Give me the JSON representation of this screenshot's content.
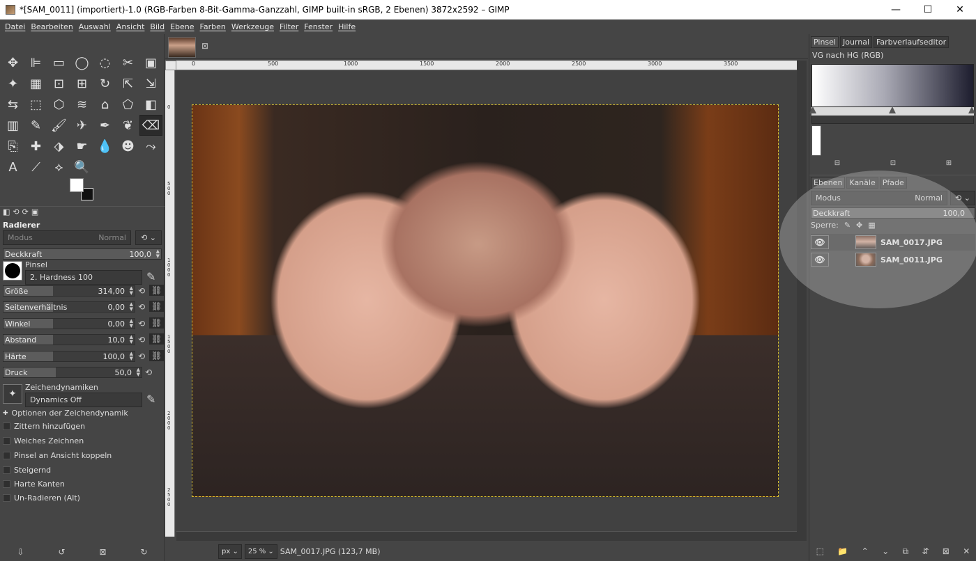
{
  "window": {
    "title": "*[SAM_0011] (importiert)-1.0 (RGB-Farben 8-Bit-Gamma-Ganzzahl, GIMP built-in sRGB, 2 Ebenen) 3872x2592 – GIMP",
    "min": "—",
    "max": "☐",
    "close": "✕"
  },
  "menu": [
    "Datei",
    "Bearbeiten",
    "Auswahl",
    "Ansicht",
    "Bild",
    "Ebene",
    "Farben",
    "Werkzeuge",
    "Filter",
    "Fenster",
    "Hilfe"
  ],
  "tools": [
    "move-tool",
    "align-tool",
    "rect-select-tool",
    "ellipse-select-tool",
    "free-select-tool",
    "scissors-tool",
    "foreground-select-tool",
    "fuzzy-select-tool",
    "color-select-tool",
    "crop-tool",
    "unified-transform-tool",
    "rotate-tool",
    "scale-tool",
    "shear-tool",
    "flip-tool",
    "perspective-tool",
    "3d-transform-tool",
    "warp-tool",
    "cage-tool",
    "handle-transform-tool",
    "bucket-fill-tool",
    "blend-tool",
    "pencil-tool",
    "paintbrush-tool",
    "airbrush-tool",
    "ink-tool",
    "mypaint-tool",
    "eraser-tool",
    "clone-tool",
    "heal-tool",
    "perspective-clone-tool",
    "smudge-tool",
    "blur-tool",
    "dodge-tool",
    "paths-tool",
    "text-tool",
    "color-picker-tool",
    "measure-tool",
    "zoom-tool"
  ],
  "tool_icons": [
    "✥",
    "⊫",
    "▭",
    "◯",
    "◌",
    "✂",
    "▣",
    "✦",
    "▦",
    "⊡",
    "⊞",
    "↻",
    "⇱",
    "⇲",
    "⇆",
    "⬚",
    "⬡",
    "≋",
    "⌂",
    "⬠",
    "◧",
    "▥",
    "✎",
    "🖌",
    "✈",
    "✒",
    "❦",
    "⌫",
    "⎘",
    "✚",
    "⬗",
    "☛",
    "💧",
    "☻",
    "⤳",
    "A",
    "⟋",
    "⟡",
    "🔍"
  ],
  "tool_options": {
    "tabs": [
      "◧",
      "⟲",
      "⟳",
      "▣"
    ],
    "title": "Radierer",
    "modus": "Modus",
    "modus_value": "Normal",
    "opacity_label": "Deckkraft",
    "opacity_value": "100,0",
    "pinsel_label": "Pinsel",
    "pinsel_value": "2. Hardness 100",
    "sliders": [
      {
        "label": "Größe",
        "value": "314,00"
      },
      {
        "label": "Seitenverhältnis",
        "value": "0,00"
      },
      {
        "label": "Winkel",
        "value": "0,00"
      },
      {
        "label": "Abstand",
        "value": "10,0"
      },
      {
        "label": "Härte",
        "value": "100,0"
      },
      {
        "label": "Druck",
        "value": "50,0"
      }
    ],
    "dynamics_label": "Zeichendynamiken",
    "dynamics_value": "Dynamics Off",
    "dyn_options_label": "Optionen der Zeichendynamik",
    "checks": [
      "Zittern hinzufügen",
      "Weiches Zeichnen",
      "Pinsel an Ansicht koppeln",
      "Steigernd",
      "Harte Kanten",
      "Un-Radieren (Alt)"
    ],
    "bottom_icons": [
      "⇩",
      "↺",
      "⊠",
      "↻"
    ]
  },
  "ruler": {
    "ticks": [
      "0",
      "500",
      "1000",
      "1500",
      "2000",
      "2500",
      "3000",
      "3500"
    ],
    "vticks": [
      "0",
      "5\n0\n0",
      "1\n0\n0\n0",
      "1\n5\n0\n0",
      "2\n0\n0\n0",
      "2\n5\n0\n0"
    ]
  },
  "status": {
    "unit": "px",
    "zoom": "25 %",
    "info": "SAM_0017.JPG (123,7 MB)"
  },
  "right": {
    "tabs": [
      "Pinsel",
      "Journal",
      "Farbverlaufseditor"
    ],
    "gradient_name": "VG nach HG (RGB)",
    "layer_tabs": [
      "Ebenen",
      "Kanäle",
      "Pfade"
    ],
    "mode_label": "Modus",
    "mode_value": "Normal",
    "opacity_label": "Deckkraft",
    "opacity_value": "100,0",
    "lock_label": "Sperre:",
    "layers": [
      {
        "name": "SAM_0017.JPG"
      },
      {
        "name": "SAM_0011.JPG"
      }
    ],
    "bottom_icons": [
      "⬚",
      "📁",
      "⌃",
      "⌄",
      "⧉",
      "⇵",
      "⊠",
      "✕"
    ]
  }
}
